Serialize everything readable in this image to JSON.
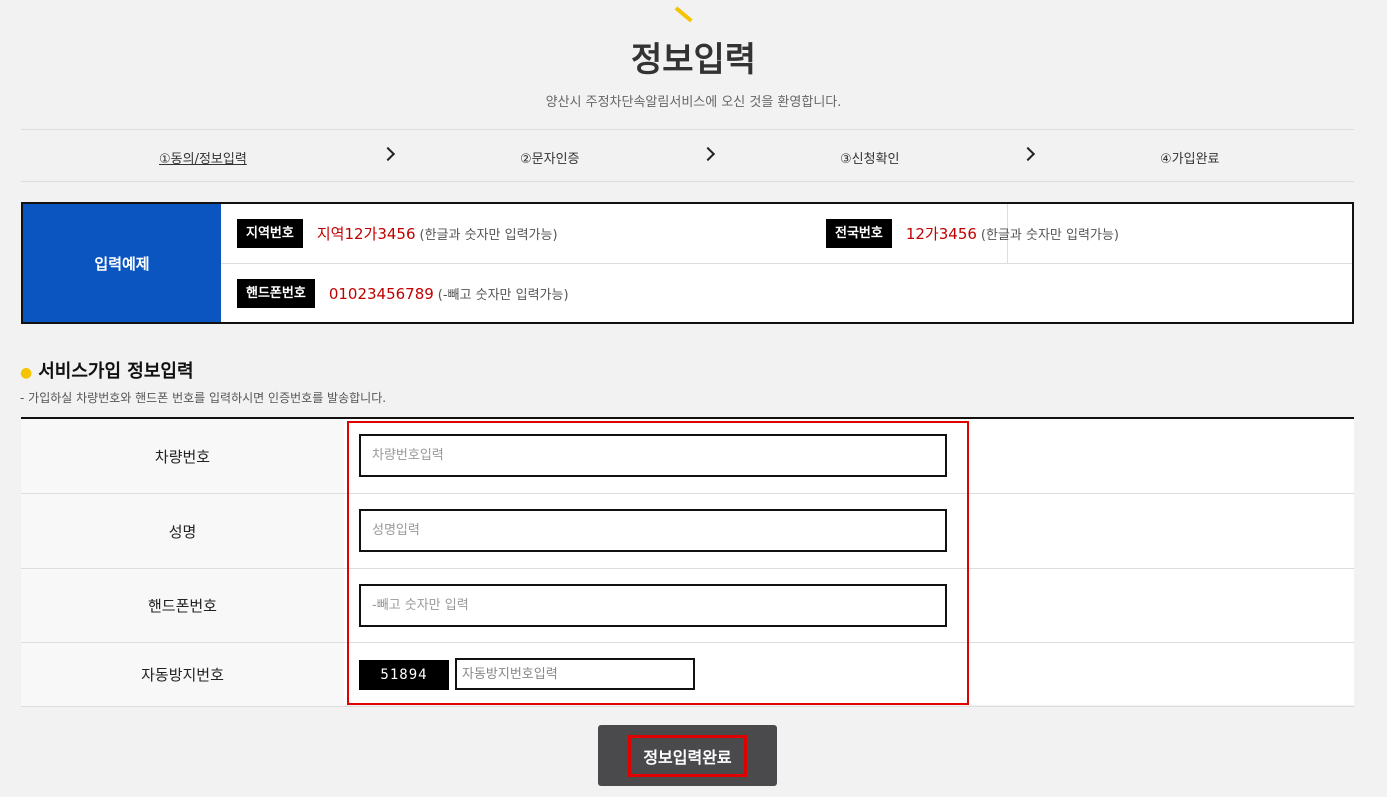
{
  "header": {
    "title": "정보입력",
    "subtitle": "양산시 주정차단속알림서비스에 오신 것을 환영합니다."
  },
  "steps": [
    {
      "label": "①동의/정보입력",
      "active": true
    },
    {
      "label": "②문자인증",
      "active": false
    },
    {
      "label": "③신청확인",
      "active": false
    },
    {
      "label": "④가입완료",
      "active": false
    }
  ],
  "example": {
    "heading": "입력예제",
    "local": {
      "tag": "지역번호",
      "value": "지역12가3456",
      "note": "(한글과 숫자만 입력가능)"
    },
    "national": {
      "tag": "전국번호",
      "value": "12가3456",
      "note": "(한글과 숫자만 입력가능)"
    },
    "phone": {
      "tag": "핸드폰번호",
      "value": "01023456789",
      "note": "(-빼고 숫자만 입력가능)"
    }
  },
  "section": {
    "title": "서비스가입 정보입력",
    "description": "가입하실 차량번호와 핸드폰 번호를 입력하시면 인증번호를 발송합니다."
  },
  "form": {
    "car_number": {
      "label": "차량번호",
      "placeholder": "차량번호입력",
      "value": ""
    },
    "name": {
      "label": "성명",
      "placeholder": "성명입력",
      "value": ""
    },
    "phone": {
      "label": "핸드폰번호",
      "placeholder": "-빼고 숫자만 입력",
      "value": ""
    },
    "captcha": {
      "label": "자동방지번호",
      "code": "51894",
      "placeholder": "자동방지번호입력",
      "value": ""
    }
  },
  "submit_label": "정보입력완료",
  "colors": {
    "accent_blue": "#0b55c0",
    "example_red": "#c00000",
    "highlight_red": "#e00000",
    "deco_yellow": "#f5c400",
    "button_gray": "#4a4a4d"
  }
}
